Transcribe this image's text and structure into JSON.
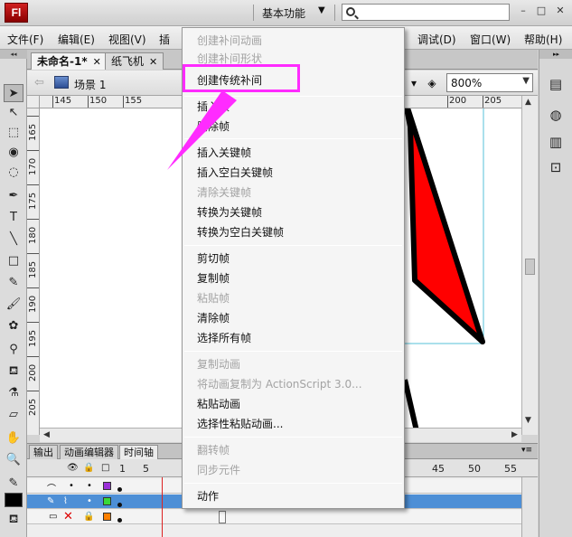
{
  "app": {
    "logo_text": "Fl",
    "workspace_label": "基本功能",
    "workspace_caret": "▼",
    "search_placeholder": "",
    "window_buttons": [
      "–",
      "□",
      "✕"
    ]
  },
  "menubar": {
    "items": [
      "文件(F)",
      "编辑(E)",
      "视图(V)",
      "插",
      "调试(D)",
      "窗口(W)",
      "帮助(H)"
    ]
  },
  "doc_tabs": [
    {
      "label": "未命名-1*",
      "close": "✕",
      "active": true
    },
    {
      "label": "纸飞机",
      "close": "✕",
      "active": false
    }
  ],
  "editbar": {
    "back_arrow": "⇦",
    "scene_label": "场景 1",
    "zoom_value": "800%",
    "zoom_caret": "▼"
  },
  "ruler": {
    "h_labels": [
      "145",
      "150",
      "155",
      "200",
      "205"
    ],
    "v_labels": [
      "165",
      "170",
      "175",
      "180",
      "185",
      "190",
      "195",
      "200",
      "205"
    ]
  },
  "stage_colors": {
    "fill": "#ff0000",
    "stroke": "#000000",
    "guide": "#55c0d8"
  },
  "panel_tabs": [
    {
      "label": "输出",
      "active": false
    },
    {
      "label": "动画编辑器",
      "active": false
    },
    {
      "label": "时间轴",
      "active": true
    }
  ],
  "timeline": {
    "frame_numbers": [
      "1",
      "5",
      "45",
      "50",
      "55"
    ],
    "header_icons": [
      "👁",
      "🔒",
      "□"
    ],
    "layer_swatches": [
      "#9b30d8",
      "#39d839",
      "#ff8000"
    ]
  },
  "context_menu": {
    "items": [
      {
        "label": "创建补间动画",
        "enabled": false
      },
      {
        "label": "创建补间形状",
        "enabled": false
      },
      {
        "label": "创建传统补间",
        "enabled": true
      },
      {
        "label": "插入帧",
        "enabled": true
      },
      {
        "label": "删除帧",
        "enabled": true
      },
      {
        "label": "插入关键帧",
        "enabled": true
      },
      {
        "label": "插入空白关键帧",
        "enabled": true
      },
      {
        "label": "清除关键帧",
        "enabled": false
      },
      {
        "label": "转换为关键帧",
        "enabled": true
      },
      {
        "label": "转换为空白关键帧",
        "enabled": true
      },
      {
        "label": "剪切帧",
        "enabled": true
      },
      {
        "label": "复制帧",
        "enabled": true
      },
      {
        "label": "粘贴帧",
        "enabled": false
      },
      {
        "label": "清除帧",
        "enabled": true
      },
      {
        "label": "选择所有帧",
        "enabled": true
      },
      {
        "label": "复制动画",
        "enabled": false
      },
      {
        "label": "将动画复制为 ActionScript 3.0...",
        "enabled": false
      },
      {
        "label": "粘贴动画",
        "enabled": true
      },
      {
        "label": "选择性粘贴动画...",
        "enabled": true
      },
      {
        "label": "翻转帧",
        "enabled": false
      },
      {
        "label": "同步元件",
        "enabled": false
      },
      {
        "label": "动作",
        "enabled": true
      }
    ]
  },
  "annotation": {
    "highlight_color": "#ff2bff"
  }
}
